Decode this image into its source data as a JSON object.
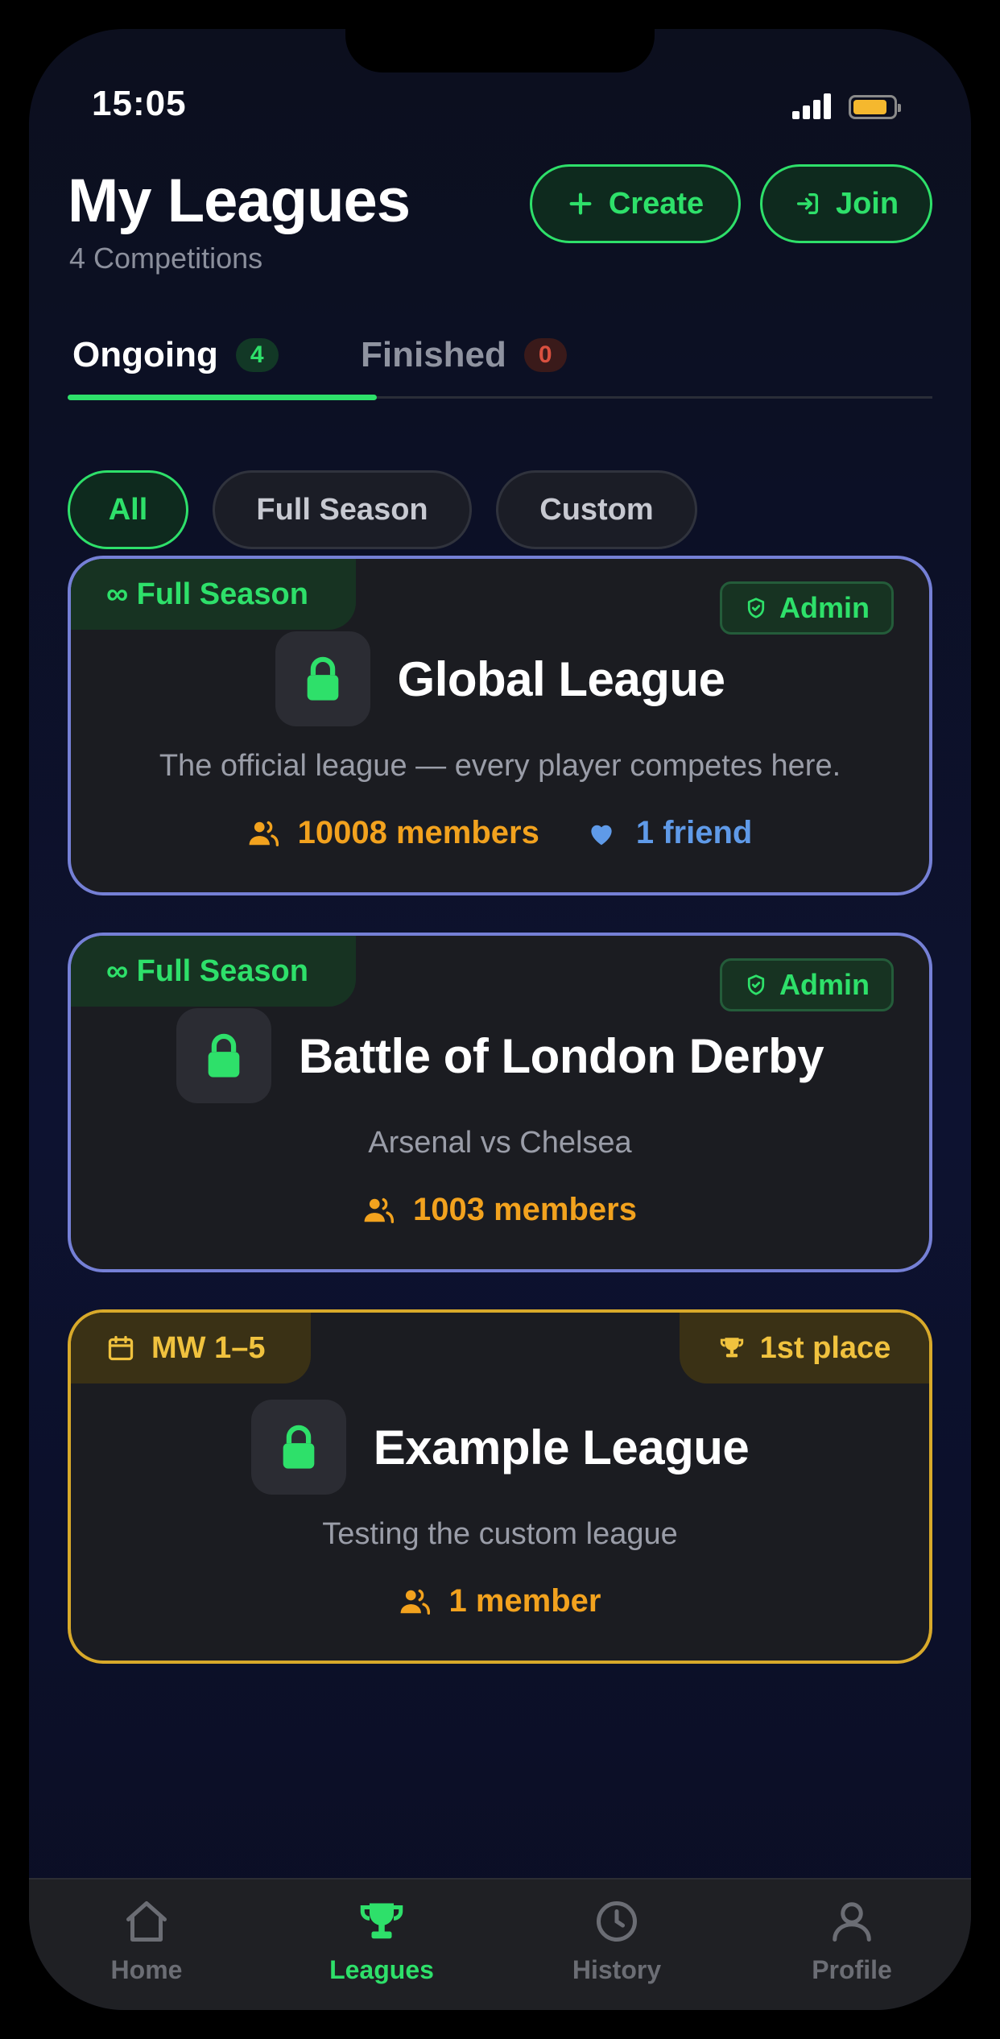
{
  "status_bar": {
    "time": "15:05",
    "battery_level": 0.85
  },
  "header": {
    "title": "My Leagues",
    "subtitle": "4 Competitions",
    "create_label": "Create",
    "join_label": "Join"
  },
  "tabs": [
    {
      "label": "Ongoing",
      "count": "4",
      "active": true
    },
    {
      "label": "Finished",
      "count": "0",
      "active": false
    }
  ],
  "filters": [
    {
      "label": "All",
      "active": true
    },
    {
      "label": "Full Season",
      "active": false
    },
    {
      "label": "Custom",
      "active": false
    }
  ],
  "leagues": [
    {
      "tag": "∞ Full Season",
      "role": "Admin",
      "title": "Global League",
      "description": "The official league — every player competes here.",
      "members": "10008 members",
      "friends": "1 friend"
    },
    {
      "tag": "∞ Full Season",
      "role": "Admin",
      "title": "Battle of London Derby",
      "description": "Arsenal vs Chelsea",
      "members": "1003 members"
    },
    {
      "tag": "MW 1–5",
      "place": "1st place",
      "title": "Example League",
      "description": "Testing the custom league",
      "members": "1 member"
    }
  ],
  "nav": [
    {
      "label": "Home",
      "icon": "home-icon"
    },
    {
      "label": "Leagues",
      "icon": "trophy-icon",
      "active": true
    },
    {
      "label": "History",
      "icon": "clock-icon"
    },
    {
      "label": "Profile",
      "icon": "user-icon"
    }
  ],
  "colors": {
    "accent_green": "#2ee06a",
    "admin_border": "#7580d6",
    "gold": "#d8a92a",
    "members_orange": "#f2a21e",
    "friends_blue": "#5f9ae8"
  }
}
